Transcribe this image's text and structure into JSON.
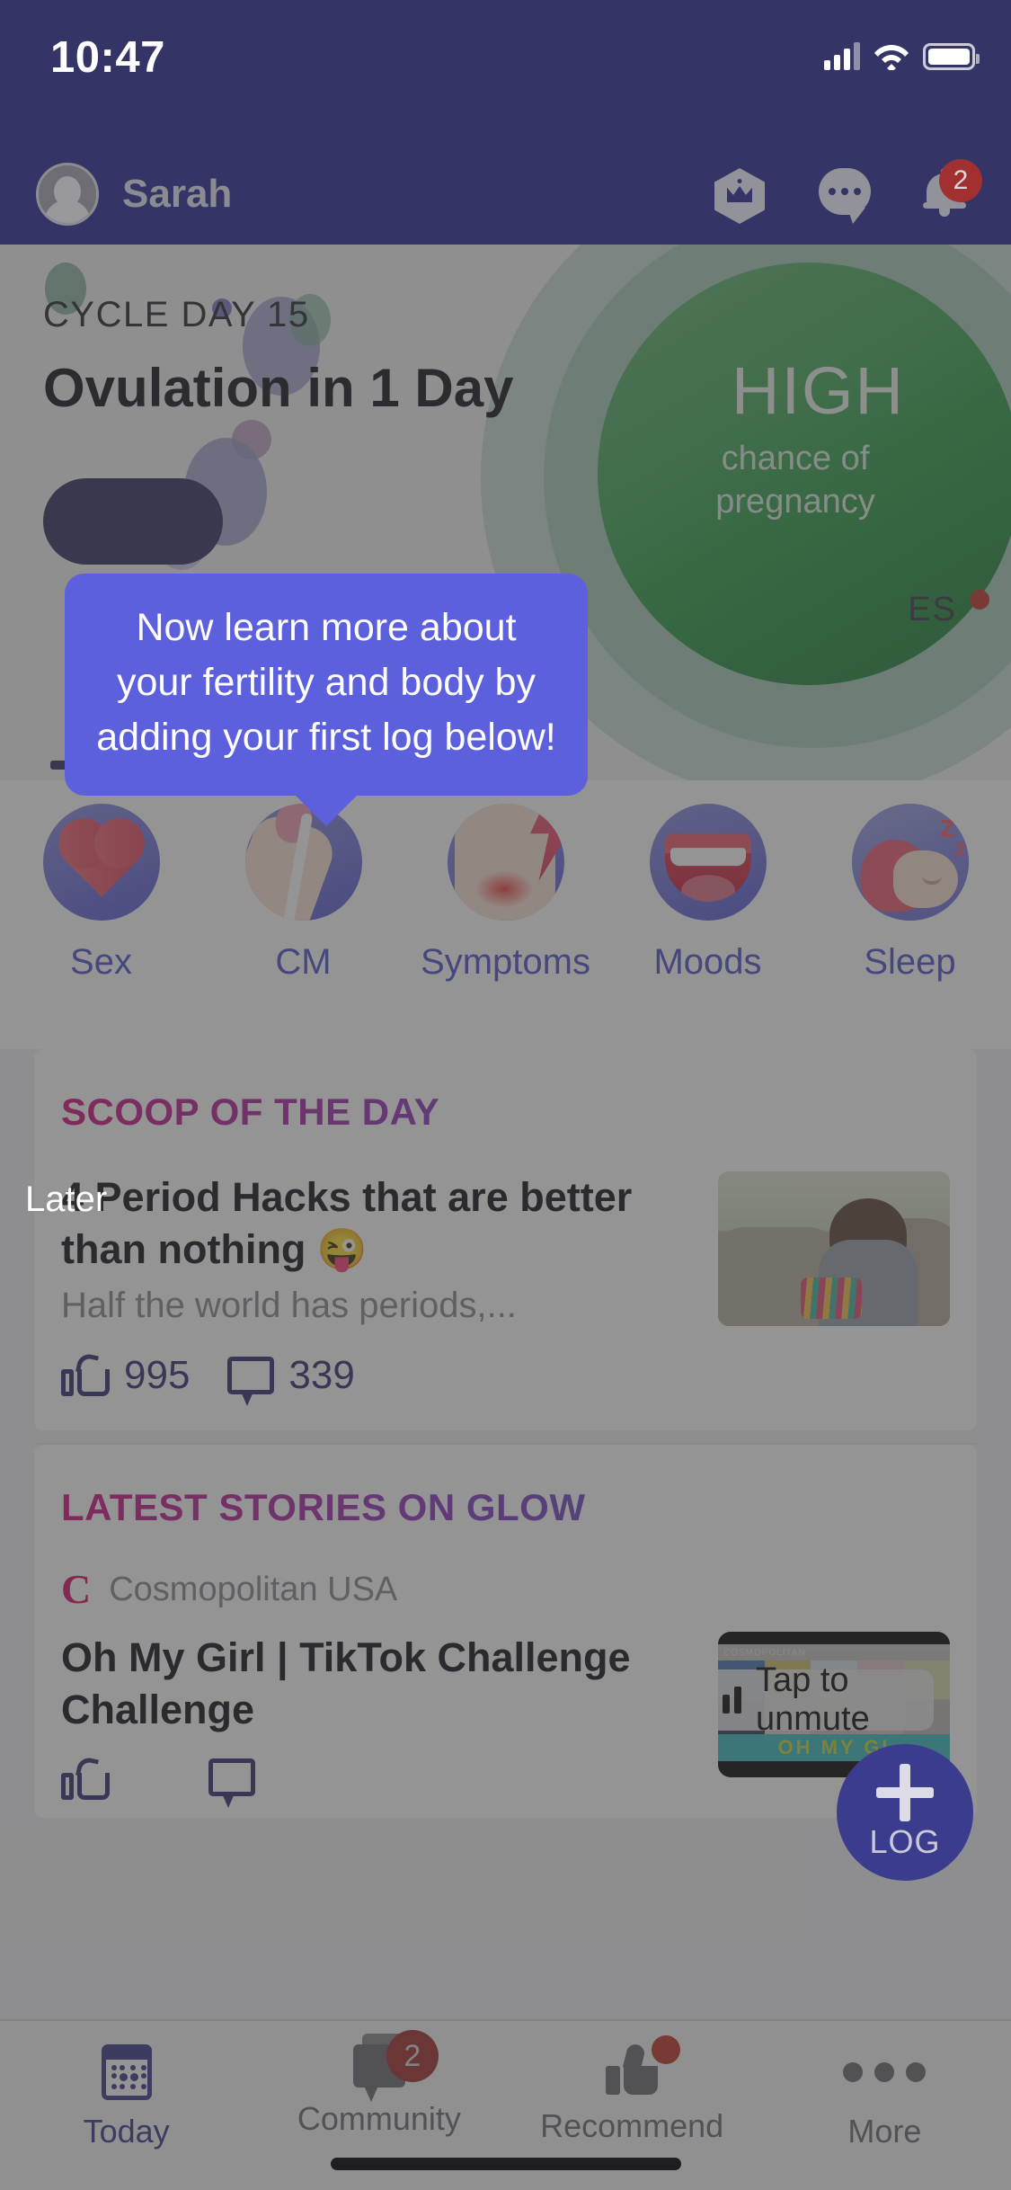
{
  "status_bar": {
    "time": "10:47",
    "icons": [
      "cellular-signal-icon",
      "wifi-icon",
      "battery-icon"
    ]
  },
  "header": {
    "username": "Sarah",
    "avatar_icon": "default-avatar-icon",
    "actions": [
      {
        "name": "premium-crown-icon",
        "label": ""
      },
      {
        "name": "chat-bubble-icon",
        "label": ""
      },
      {
        "name": "notification-bell-icon",
        "badge": "2"
      }
    ]
  },
  "hero": {
    "cycle_day_label": "CYCLE DAY 15",
    "title": "Ovulation in 1 Day",
    "chance_level": "HIGH",
    "chance_caption": "chance of\npregnancy",
    "right_label": "ES"
  },
  "tooltip": {
    "message": "Now learn more about your fertility and body by adding your first log below!",
    "color": "#5d60dd",
    "dismiss_label": "Later"
  },
  "log_strip": {
    "items": [
      {
        "label": "Sex",
        "icon": "heart-icon"
      },
      {
        "label": "CM",
        "icon": "cervical-mucus-icon"
      },
      {
        "label": "Symptoms",
        "icon": "symptoms-lightning-icon"
      },
      {
        "label": "Moods",
        "icon": "mouth-icon"
      },
      {
        "label": "Sleep",
        "icon": "sleeping-person-icon"
      }
    ]
  },
  "scoop": {
    "section_title": "SCOOP OF THE DAY",
    "article_title": "4 Period Hacks that are better than nothing 😜",
    "article_snippet": "Half the world has periods,...",
    "likes": "995",
    "comments": "339",
    "like_icon": "thumbs-up-icon",
    "comment_icon": "comment-bubble-icon",
    "image_name": "woman-with-heating-pad-photo"
  },
  "stories": {
    "section_title": "LATEST STORIES ON GLOW",
    "source_logo": "C",
    "source_name": "Cosmopolitan USA",
    "story_title": "Oh My Girl | TikTok Challenge Challenge",
    "video_overlay": "Tap to unmute",
    "video_caption": "OH MY GI",
    "video_watermark": "COSMOPOLITAN",
    "like_icon": "thumbs-up-icon",
    "comment_icon": "comment-bubble-icon"
  },
  "fab": {
    "label": "LOG",
    "icon": "plus-icon",
    "color": "#3c3c8e"
  },
  "tab_bar": {
    "items": [
      {
        "label": "Today",
        "icon": "calendar-icon",
        "active": true,
        "badge": ""
      },
      {
        "label": "Community",
        "icon": "chat-icon",
        "active": false,
        "badge": "2"
      },
      {
        "label": "Recommend",
        "icon": "thumbs-up-icon",
        "active": false,
        "badge": "dot"
      },
      {
        "label": "More",
        "icon": "ellipsis-icon",
        "active": false,
        "badge": ""
      }
    ]
  },
  "colors": {
    "header_bg": "#343467",
    "accent": "#5d60dd",
    "fertility_high": "#35a04d",
    "badge_red": "#a33030"
  }
}
